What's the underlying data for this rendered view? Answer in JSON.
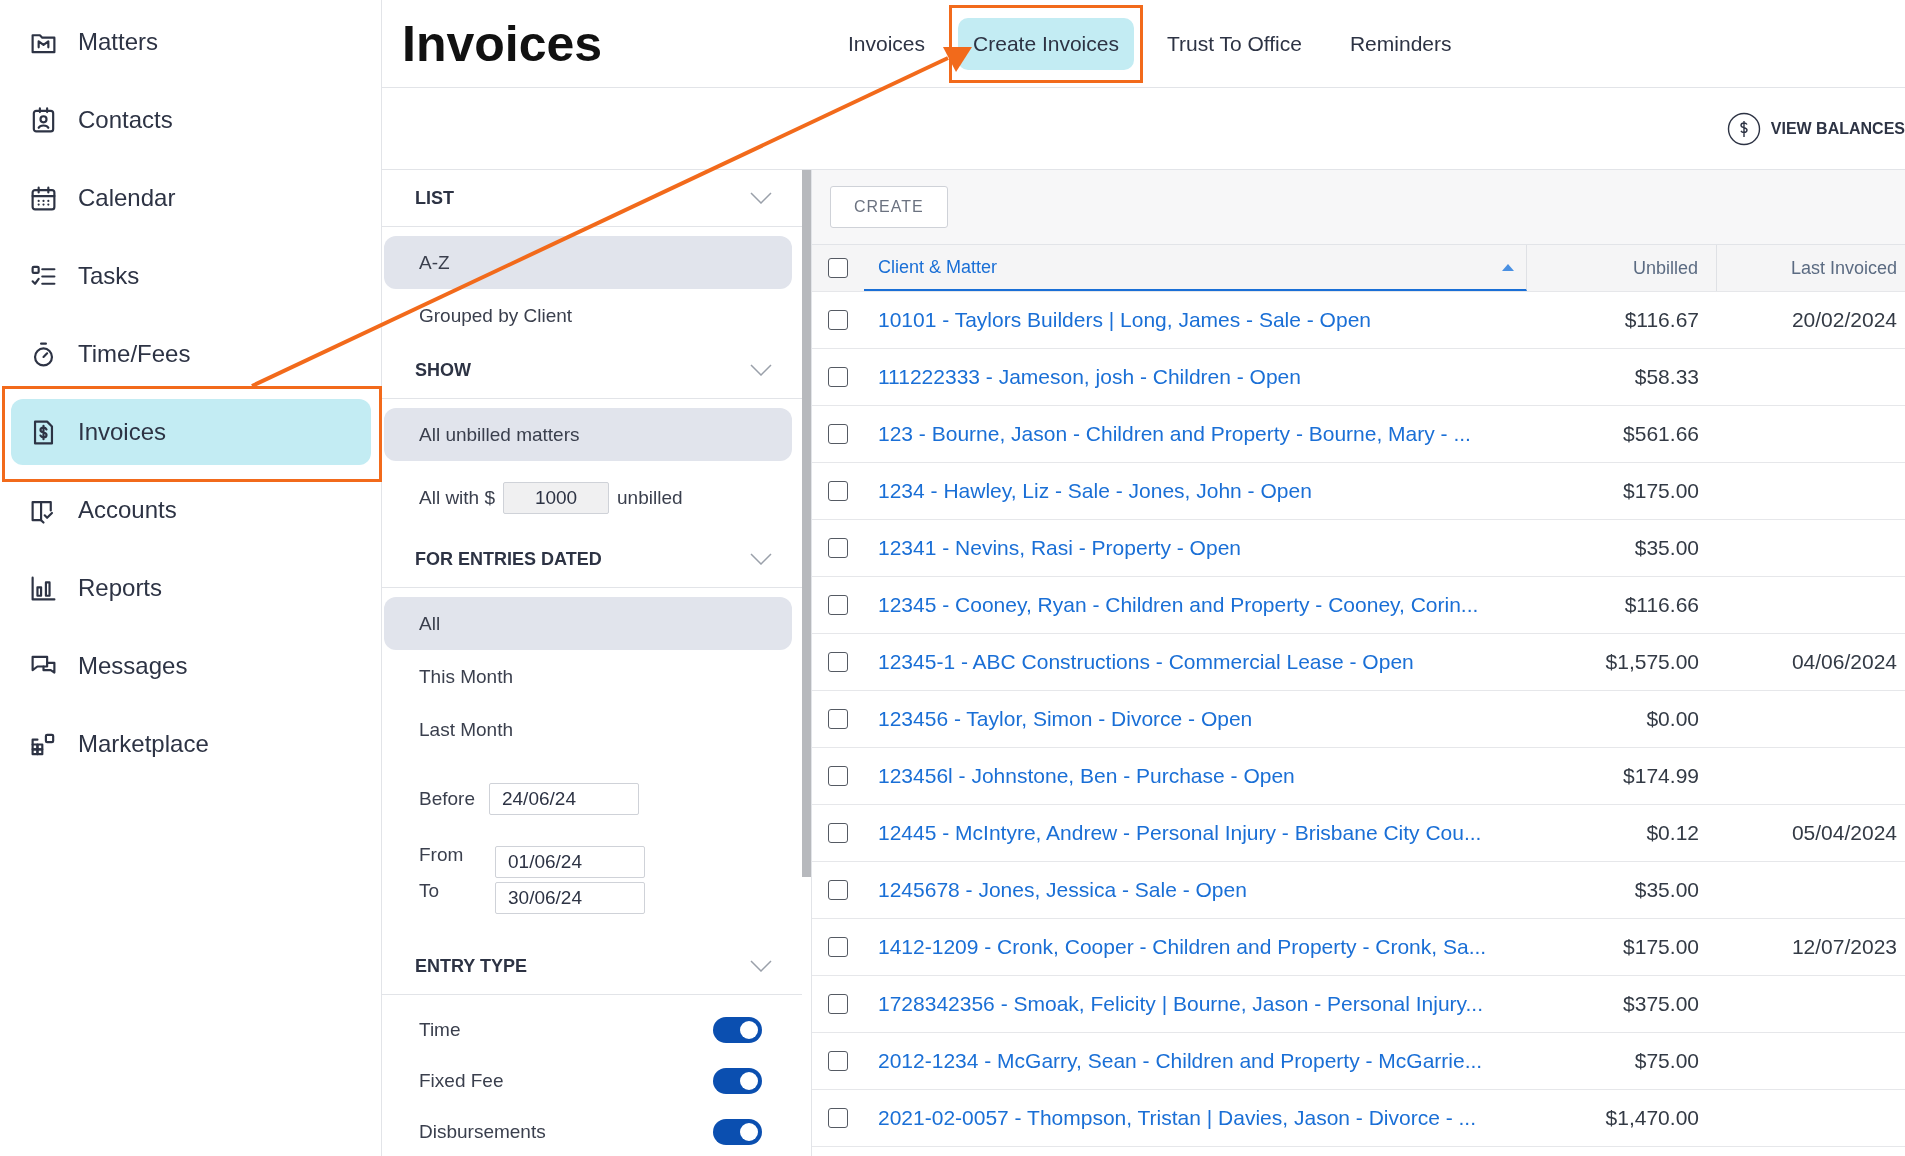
{
  "sidebar": {
    "items": [
      {
        "label": "Matters",
        "selected": false,
        "highlighted": false
      },
      {
        "label": "Contacts",
        "selected": false,
        "highlighted": false
      },
      {
        "label": "Calendar",
        "selected": false,
        "highlighted": false
      },
      {
        "label": "Tasks",
        "selected": false,
        "highlighted": false
      },
      {
        "label": "Time/Fees",
        "selected": false,
        "highlighted": false
      },
      {
        "label": "Invoices",
        "selected": true,
        "highlighted": true
      },
      {
        "label": "Accounts",
        "selected": false,
        "highlighted": false
      },
      {
        "label": "Reports",
        "selected": false,
        "highlighted": false
      },
      {
        "label": "Messages",
        "selected": false,
        "highlighted": false
      },
      {
        "label": "Marketplace",
        "selected": false,
        "highlighted": false
      }
    ]
  },
  "page_title": "Invoices",
  "tabs": [
    {
      "label": "Invoices",
      "selected": false,
      "highlighted": false
    },
    {
      "label": "Create Invoices",
      "selected": true,
      "highlighted": true
    },
    {
      "label": "Trust To Office",
      "selected": false,
      "highlighted": false
    },
    {
      "label": "Reminders",
      "selected": false,
      "highlighted": false
    }
  ],
  "view_balances": "VIEW BALANCES",
  "filters": [
    {
      "title": "LIST",
      "options": [
        {
          "kind": "option",
          "label": "A-Z",
          "selected": true
        },
        {
          "kind": "option",
          "label": "Grouped by Client",
          "selected": false
        }
      ]
    },
    {
      "title": "SHOW",
      "options": [
        {
          "kind": "option",
          "label": "All unbilled matters",
          "selected": true
        },
        {
          "kind": "amount",
          "label": "All with $",
          "value": "1000",
          "suffix": "unbilled",
          "selected": false
        }
      ]
    },
    {
      "title": "FOR ENTRIES DATED",
      "options": [
        {
          "kind": "option",
          "label": "All",
          "selected": true
        },
        {
          "kind": "option",
          "label": "This Month",
          "selected": false
        },
        {
          "kind": "option",
          "label": "Last Month",
          "selected": false
        },
        {
          "kind": "date",
          "label": "Before",
          "value": "24/06/24",
          "selected": false
        },
        {
          "kind": "range",
          "from_label": "From",
          "from": "01/06/24",
          "to_label": "To",
          "to": "30/06/24",
          "selected": false
        }
      ]
    },
    {
      "title": "ENTRY TYPE",
      "options": [
        {
          "kind": "toggle",
          "label": "Time",
          "on": true
        },
        {
          "kind": "toggle",
          "label": "Fixed Fee",
          "on": true
        },
        {
          "kind": "toggle",
          "label": "Disbursements",
          "on": true
        }
      ]
    }
  ],
  "create_button": "CREATE",
  "table": {
    "select_all_checked": false,
    "columns": [
      {
        "label": "Client & Matter",
        "sorted": true
      },
      {
        "label": "Unbilled",
        "sorted": false
      },
      {
        "label": "Last Invoiced",
        "sorted": false
      }
    ],
    "rows": [
      {
        "checked": false,
        "matter": "10101 - Taylors Builders | Long, James - Sale - Open",
        "unbilled": "$116.67",
        "last_invoiced": "20/02/2024"
      },
      {
        "checked": false,
        "matter": "111222333 - Jameson, josh - Children - Open",
        "unbilled": "$58.33"
      },
      {
        "checked": false,
        "matter": "123 - Bourne, Jason - Children and Property - Bourne, Mary - ...",
        "unbilled": "$561.66"
      },
      {
        "checked": false,
        "matter": "1234 - Hawley, Liz - Sale - Jones, John - Open",
        "unbilled": "$175.00"
      },
      {
        "checked": false,
        "matter": "12341 - Nevins, Rasi - Property - Open",
        "unbilled": "$35.00"
      },
      {
        "checked": false,
        "matter": "12345 - Cooney, Ryan - Children and Property - Cooney, Corin...",
        "unbilled": "$116.66"
      },
      {
        "checked": false,
        "matter": "12345-1 - ABC Constructions - Commercial Lease - Open",
        "unbilled": "$1,575.00",
        "last_invoiced": "04/06/2024"
      },
      {
        "checked": false,
        "matter": "123456 - Taylor, Simon - Divorce - Open",
        "unbilled": "$0.00"
      },
      {
        "checked": false,
        "matter": "123456l - Johnstone, Ben - Purchase - Open",
        "unbilled": "$174.99"
      },
      {
        "checked": false,
        "matter": "12445 - McIntyre, Andrew - Personal Injury - Brisbane City Cou...",
        "unbilled": "$0.12",
        "last_invoiced": "05/04/2024"
      },
      {
        "checked": false,
        "matter": "1245678 - Jones, Jessica - Sale - Open",
        "unbilled": "$35.00"
      },
      {
        "checked": false,
        "matter": "1412-1209 - Cronk, Cooper - Children and Property - Cronk, Sa...",
        "unbilled": "$175.00",
        "last_invoiced": "12/07/2023"
      },
      {
        "checked": false,
        "matter": "1728342356 - Smoak, Felicity | Bourne, Jason - Personal Injury...",
        "unbilled": "$375.00"
      },
      {
        "checked": false,
        "matter": "2012-1234 - McGarry, Sean - Children and Property - McGarrie...",
        "unbilled": "$75.00"
      },
      {
        "checked": false,
        "matter": "2021-02-0057 - Thompson, Tristan | Davies, Jason - Divorce - ...",
        "unbilled": "$1,470.00"
      }
    ]
  }
}
